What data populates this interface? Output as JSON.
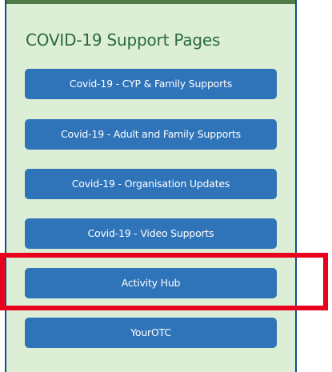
{
  "panel": {
    "title": "COVID-19 Support Pages"
  },
  "buttons": [
    {
      "label": "Covid-19 - CYP & Family Supports"
    },
    {
      "label": "Covid-19 - Adult and Family Supports"
    },
    {
      "label": "Covid-19 - Organisation Updates"
    },
    {
      "label": "Covid-19 - Video Supports"
    },
    {
      "label": "Activity Hub",
      "highlighted": true
    },
    {
      "label": "YourOTC"
    }
  ],
  "colors": {
    "panel_background": "#dcefd6",
    "panel_border": "#0d4f86",
    "top_bar": "#4d7a45",
    "title_text": "#2a6b3d",
    "button_background": "#2f73b9",
    "button_text": "#ffffff",
    "highlight": "#e8001c"
  }
}
